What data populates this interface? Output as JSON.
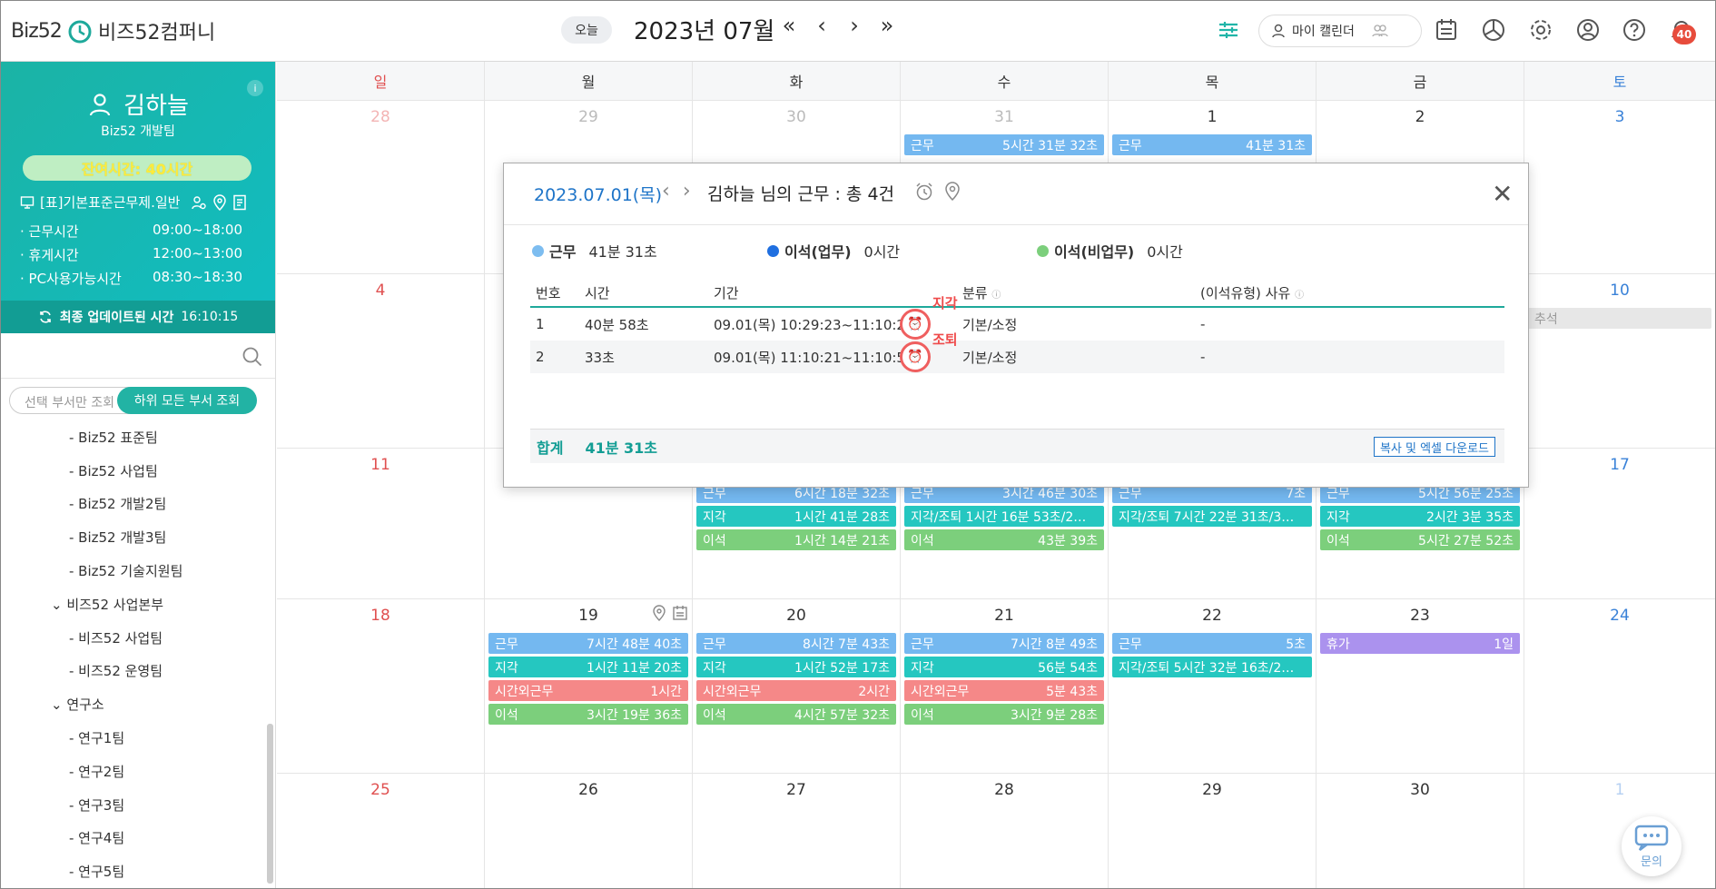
{
  "header": {
    "logo": "Biz52",
    "company": "비즈52컴퍼니",
    "today": "오늘",
    "month": "2023년 07월",
    "nav": [
      "«",
      "‹",
      "›",
      "»"
    ],
    "calendar_switch": "마이 캘린더",
    "notification_count": "40",
    "icons": [
      "filter-sliders-icon",
      "calendar-list-icon",
      "pie-chart-icon",
      "gear-icon",
      "user-circle-icon",
      "help-icon",
      "bell-icon"
    ]
  },
  "sidebar": {
    "name": "김하늘",
    "team": "Biz52 개발팀",
    "remain": "잔여시간: 40시간",
    "rule": "[표]기본표준근무제.일반",
    "hours": [
      {
        "k": "· 근무시간",
        "v": "09:00~18:00"
      },
      {
        "k": "· 휴게시간",
        "v": "12:00~13:00"
      },
      {
        "k": "· PC사용가능시간",
        "v": "08:30~18:30"
      }
    ],
    "update_label": "최종 업데이트된 시간",
    "update_time": "16:10:15",
    "toggle_off": "선택 부서만 조회",
    "toggle_on": "하위 모든 부서 조회",
    "tree": [
      {
        "label": "- Biz52 표준팀",
        "level": 2
      },
      {
        "label": "- Biz52 사업팀",
        "level": 2
      },
      {
        "label": "- Biz52 개발2팀",
        "level": 2
      },
      {
        "label": "- Biz52 개발3팀",
        "level": 2
      },
      {
        "label": "- Biz52 기술지원팀",
        "level": 2
      },
      {
        "label": "⌄ 비즈52 사업본부",
        "level": 1
      },
      {
        "label": "- 비즈52 사업팀",
        "level": 2
      },
      {
        "label": "- 비즈52 운영팀",
        "level": 2
      },
      {
        "label": "⌄ 연구소",
        "level": 1
      },
      {
        "label": "- 연구1팀",
        "level": 2
      },
      {
        "label": "- 연구2팀",
        "level": 2
      },
      {
        "label": "- 연구3팀",
        "level": 2
      },
      {
        "label": "- 연구4팀",
        "level": 2
      },
      {
        "label": "- 연구5팀",
        "level": 2
      }
    ]
  },
  "calendar": {
    "weekdays": [
      "일",
      "월",
      "화",
      "수",
      "목",
      "금",
      "토"
    ],
    "weekday_colors": [
      "#e05050",
      "#333333",
      "#333333",
      "#333333",
      "#333333",
      "#333333",
      "#3a82d8"
    ],
    "weeks": [
      {
        "days": [
          "28",
          "29",
          "30",
          "31",
          "1",
          "2",
          "3"
        ],
        "muted": [
          true,
          true,
          true,
          true,
          false,
          false,
          false
        ]
      },
      {
        "days": [
          "4",
          "",
          "",
          "",
          "",
          "",
          "10"
        ],
        "muted": [
          false,
          false,
          false,
          false,
          false,
          false,
          false
        ]
      },
      {
        "days": [
          "11",
          "",
          "",
          "",
          "",
          "",
          "17"
        ],
        "muted": [
          false,
          false,
          false,
          false,
          false,
          false,
          false
        ]
      },
      {
        "days": [
          "18",
          "19",
          "20",
          "21",
          "22",
          "23",
          "24"
        ],
        "muted": [
          false,
          false,
          false,
          false,
          false,
          false,
          false
        ]
      },
      {
        "days": [
          "25",
          "26",
          "27",
          "28",
          "29",
          "30",
          "1"
        ],
        "muted": [
          false,
          false,
          false,
          false,
          false,
          false,
          true
        ]
      }
    ],
    "events": [
      {
        "week": 0,
        "day": 3,
        "row": 0,
        "color": "blue",
        "label": "근무",
        "value": "5시간 31분 32초"
      },
      {
        "week": 0,
        "day": 4,
        "row": 0,
        "color": "blue",
        "label": "근무",
        "value": "41분 31초"
      },
      {
        "week": 1,
        "day": 6,
        "row": 0,
        "color": "grey",
        "label": "추석",
        "value": ""
      },
      {
        "week": 2,
        "day": 2,
        "row": 0,
        "color": "blue",
        "label": "근무",
        "value": "6시간 18분 32초"
      },
      {
        "week": 2,
        "day": 2,
        "row": 1,
        "color": "teal",
        "label": "지각",
        "value": "1시간 41분 28초"
      },
      {
        "week": 2,
        "day": 2,
        "row": 2,
        "color": "green",
        "label": "이석",
        "value": "1시간 14분 21초"
      },
      {
        "week": 2,
        "day": 3,
        "row": 0,
        "color": "blue",
        "label": "근무",
        "value": "3시간 46분 30초"
      },
      {
        "week": 2,
        "day": 3,
        "row": 1,
        "color": "teal",
        "label": "지각/조퇴 1시간 16분 53초/2…",
        "value": ""
      },
      {
        "week": 2,
        "day": 3,
        "row": 2,
        "color": "green",
        "label": "이석",
        "value": "43분 39초"
      },
      {
        "week": 2,
        "day": 4,
        "row": 0,
        "color": "blue",
        "label": "근무",
        "value": "7초"
      },
      {
        "week": 2,
        "day": 4,
        "row": 1,
        "color": "teal",
        "label": "지각/조퇴 7시간 22분 31초/3…",
        "value": ""
      },
      {
        "week": 2,
        "day": 5,
        "row": 0,
        "color": "blue",
        "label": "근무",
        "value": "5시간 56분 25초"
      },
      {
        "week": 2,
        "day": 5,
        "row": 1,
        "color": "teal",
        "label": "지각",
        "value": "2시간 3분 35초"
      },
      {
        "week": 2,
        "day": 5,
        "row": 2,
        "color": "green",
        "label": "이석",
        "value": "5시간 27분 52초"
      },
      {
        "week": 3,
        "day": 1,
        "row": 0,
        "color": "blue",
        "label": "근무",
        "value": "7시간 48분 40초"
      },
      {
        "week": 3,
        "day": 1,
        "row": 1,
        "color": "teal",
        "label": "지각",
        "value": "1시간 11분 20초"
      },
      {
        "week": 3,
        "day": 1,
        "row": 2,
        "color": "red",
        "label": "시간외근무",
        "value": "1시간"
      },
      {
        "week": 3,
        "day": 1,
        "row": 3,
        "color": "green",
        "label": "이석",
        "value": "3시간 19분 36초"
      },
      {
        "week": 3,
        "day": 2,
        "row": 0,
        "color": "blue",
        "label": "근무",
        "value": "8시간 7분 43초"
      },
      {
        "week": 3,
        "day": 2,
        "row": 1,
        "color": "teal",
        "label": "지각",
        "value": "1시간 52분 17초"
      },
      {
        "week": 3,
        "day": 2,
        "row": 2,
        "color": "red",
        "label": "시간외근무",
        "value": "2시간"
      },
      {
        "week": 3,
        "day": 2,
        "row": 3,
        "color": "green",
        "label": "이석",
        "value": "4시간 57분 32초"
      },
      {
        "week": 3,
        "day": 3,
        "row": 0,
        "color": "blue",
        "label": "근무",
        "value": "7시간 8분 49초"
      },
      {
        "week": 3,
        "day": 3,
        "row": 1,
        "color": "teal",
        "label": "지각",
        "value": "56분 54초"
      },
      {
        "week": 3,
        "day": 3,
        "row": 2,
        "color": "red",
        "label": "시간외근무",
        "value": "5분 43초"
      },
      {
        "week": 3,
        "day": 3,
        "row": 3,
        "color": "green",
        "label": "이석",
        "value": "3시간 9분 28초"
      },
      {
        "week": 3,
        "day": 4,
        "row": 0,
        "color": "blue",
        "label": "근무",
        "value": "5초"
      },
      {
        "week": 3,
        "day": 4,
        "row": 1,
        "color": "teal",
        "label": "지각/조퇴 5시간 32분 16초/2…",
        "value": ""
      },
      {
        "week": 3,
        "day": 5,
        "row": 0,
        "color": "purple",
        "label": "휴가",
        "value": "1일"
      }
    ]
  },
  "modal": {
    "date": "2023.07.01(목)",
    "title": "김하늘 님의 근무 : 총 4건",
    "legend": [
      {
        "label": "근무",
        "value": "41분 31초",
        "color": "#7dbdf0"
      },
      {
        "label": "이석(업무)",
        "value": "0시간",
        "color": "#1f6fe0"
      },
      {
        "label": "이석(비업무)",
        "value": "0시간",
        "color": "#7ccf7c"
      }
    ],
    "columns": [
      "번호",
      "시간",
      "기간",
      "분류",
      "(이석유형) 사유"
    ],
    "rows": [
      {
        "no": "1",
        "time": "40분 58초",
        "period": "09.01(목) 10:29:23~11:10:2",
        "type": "기본/소정",
        "reason": "-",
        "flag": "지각"
      },
      {
        "no": "2",
        "time": "33초",
        "period": "09.01(목) 11:10:21~11:10:54",
        "type": "기본/소정",
        "reason": "-",
        "flag": "조퇴"
      }
    ],
    "total_label": "합계",
    "total_value": "41분 31초",
    "excel_button": "복사 및 엑셀 다운로드"
  },
  "chat_label": "문의"
}
